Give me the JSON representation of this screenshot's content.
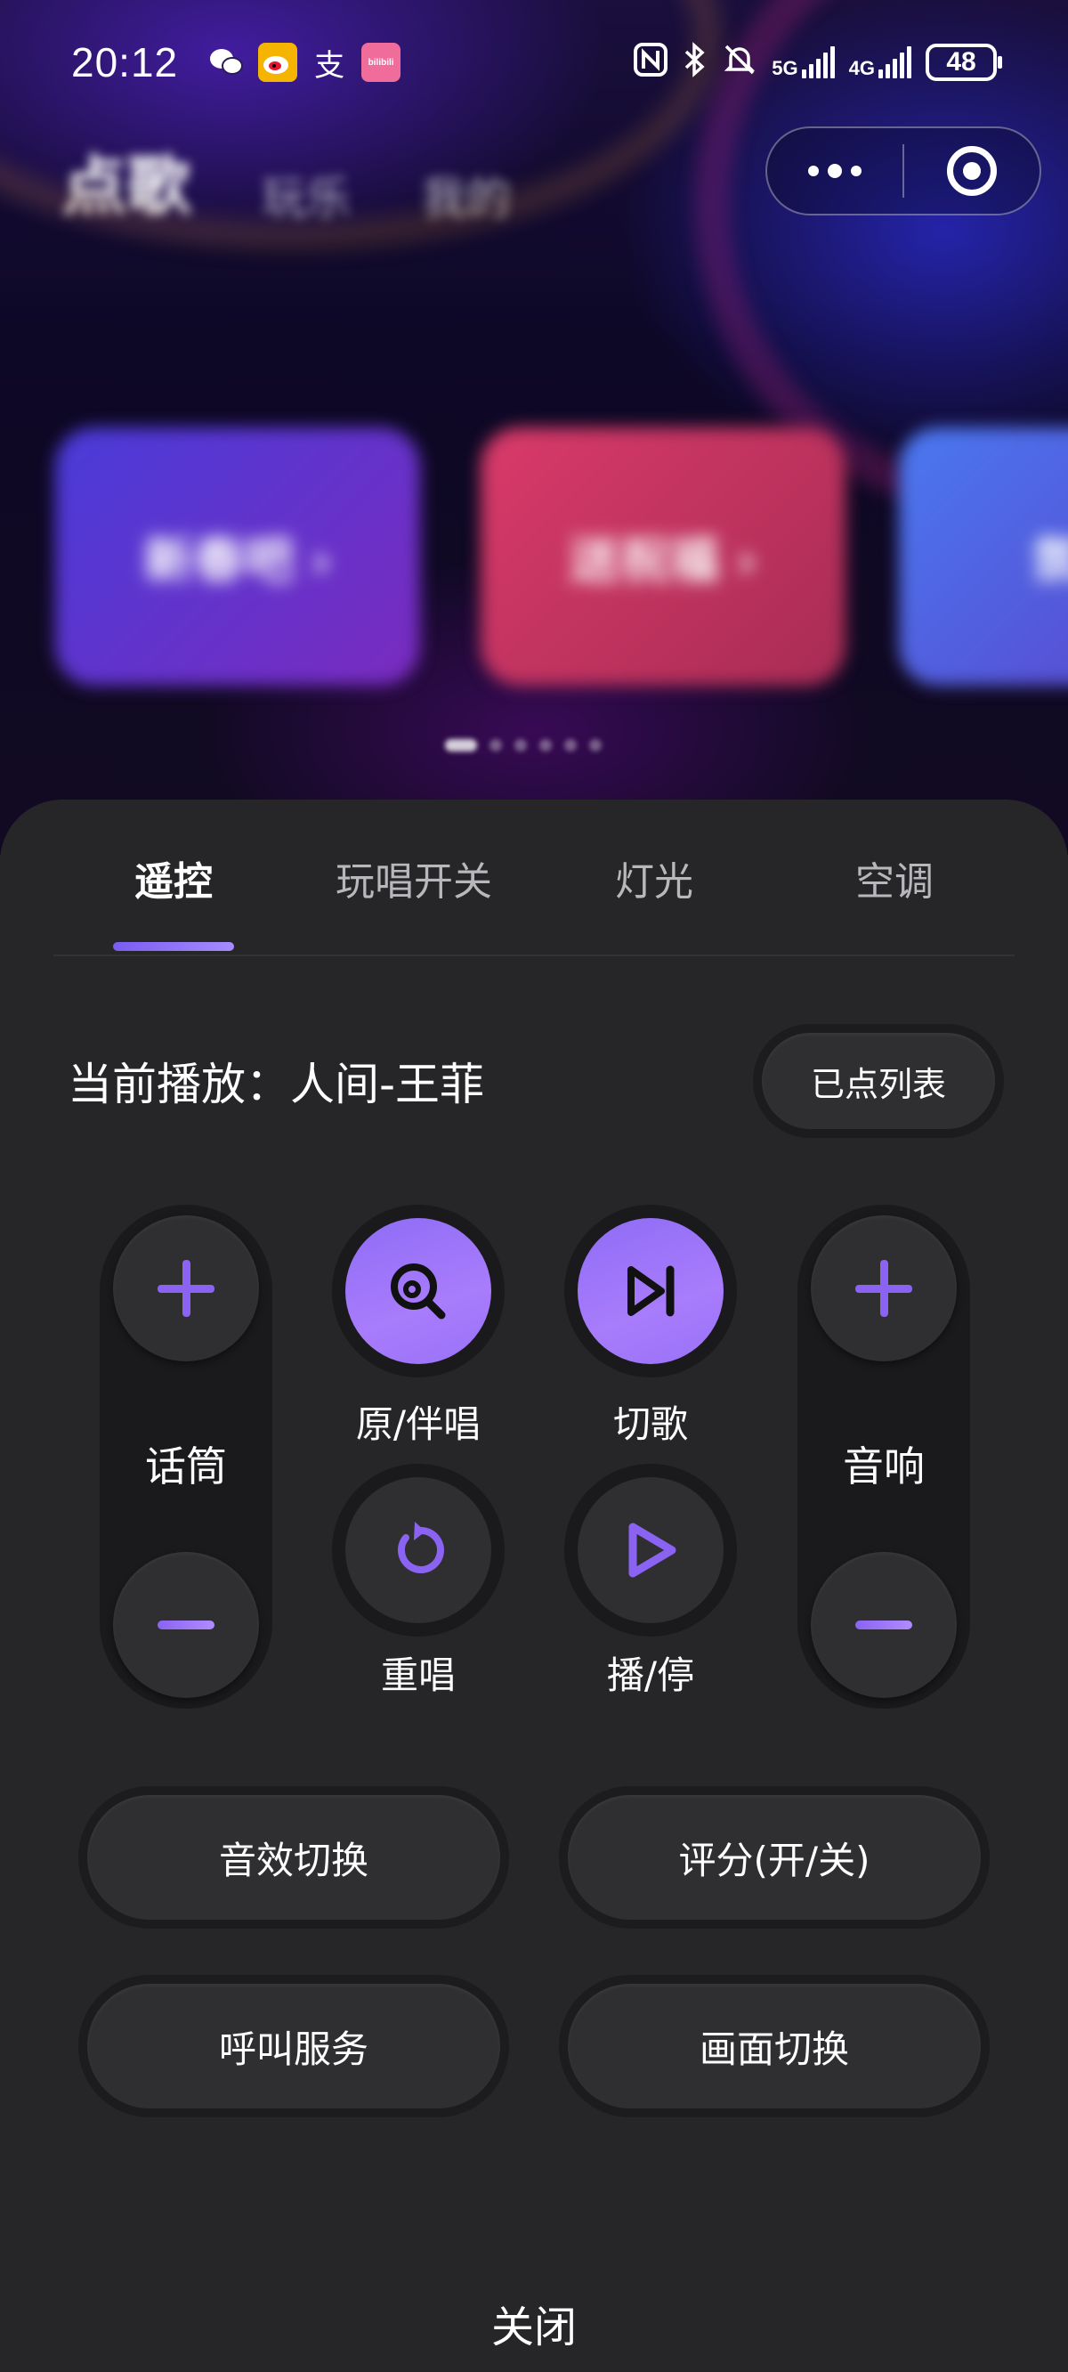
{
  "status_bar": {
    "time": "20:12",
    "alipay_glyph": "支",
    "bilibili_label": "bilibili",
    "net_5g": "5G",
    "net_4g": "4G",
    "battery": "48"
  },
  "background": {
    "header_main": "点歌",
    "header_tab_2": "玩乐",
    "header_tab_3": "我的",
    "cards": [
      "新春吧 ›",
      "送祝福 ›",
      "氛围"
    ]
  },
  "sheet": {
    "tabs": [
      "遥控",
      "玩唱开关",
      "灯光",
      "空调"
    ],
    "active_tab": 0,
    "now_playing": "当前播放：人间-王菲",
    "queue_button": "已点列表",
    "mic_label": "话筒",
    "speaker_label": "音响",
    "original_accompaniment": "原/伴唱",
    "skip_song": "切歌",
    "replay": "重唱",
    "play_pause": "播/停",
    "buttons": [
      "音效切换",
      "评分(开/关)",
      "呼叫服务",
      "画面切换"
    ],
    "close": "关闭"
  },
  "colors": {
    "accent": "#8A63F2",
    "sheet_bg": "#262628",
    "button_bg": "#2F2F32"
  }
}
